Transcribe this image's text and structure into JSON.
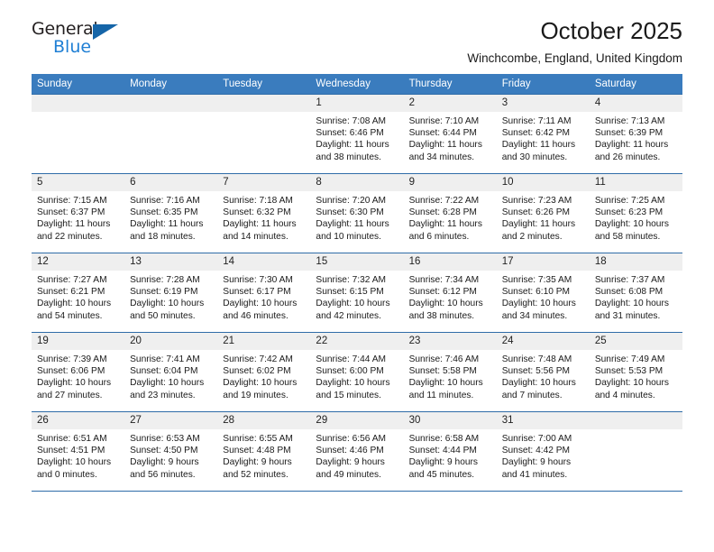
{
  "brand": {
    "name_part1": "General",
    "name_part2": "Blue",
    "triangle_color": "#1565a8",
    "blue_color": "#1f7fd4"
  },
  "header": {
    "title": "October 2025",
    "subtitle": "Winchcombe, England, United Kingdom"
  },
  "theme": {
    "header_bg": "#3a7cbe",
    "row_line": "#2f6ca8",
    "daynum_bg": "#efefef"
  },
  "weekdays": [
    "Sunday",
    "Monday",
    "Tuesday",
    "Wednesday",
    "Thursday",
    "Friday",
    "Saturday"
  ],
  "weeks": [
    [
      {
        "day": "",
        "empty": true,
        "sunrise": "",
        "sunset": "",
        "daylight1": "",
        "daylight2": ""
      },
      {
        "day": "",
        "empty": true,
        "sunrise": "",
        "sunset": "",
        "daylight1": "",
        "daylight2": ""
      },
      {
        "day": "",
        "empty": true,
        "sunrise": "",
        "sunset": "",
        "daylight1": "",
        "daylight2": ""
      },
      {
        "day": "1",
        "sunrise": "Sunrise: 7:08 AM",
        "sunset": "Sunset: 6:46 PM",
        "daylight1": "Daylight: 11 hours",
        "daylight2": "and 38 minutes."
      },
      {
        "day": "2",
        "sunrise": "Sunrise: 7:10 AM",
        "sunset": "Sunset: 6:44 PM",
        "daylight1": "Daylight: 11 hours",
        "daylight2": "and 34 minutes."
      },
      {
        "day": "3",
        "sunrise": "Sunrise: 7:11 AM",
        "sunset": "Sunset: 6:42 PM",
        "daylight1": "Daylight: 11 hours",
        "daylight2": "and 30 minutes."
      },
      {
        "day": "4",
        "sunrise": "Sunrise: 7:13 AM",
        "sunset": "Sunset: 6:39 PM",
        "daylight1": "Daylight: 11 hours",
        "daylight2": "and 26 minutes."
      }
    ],
    [
      {
        "day": "5",
        "sunrise": "Sunrise: 7:15 AM",
        "sunset": "Sunset: 6:37 PM",
        "daylight1": "Daylight: 11 hours",
        "daylight2": "and 22 minutes."
      },
      {
        "day": "6",
        "sunrise": "Sunrise: 7:16 AM",
        "sunset": "Sunset: 6:35 PM",
        "daylight1": "Daylight: 11 hours",
        "daylight2": "and 18 minutes."
      },
      {
        "day": "7",
        "sunrise": "Sunrise: 7:18 AM",
        "sunset": "Sunset: 6:32 PM",
        "daylight1": "Daylight: 11 hours",
        "daylight2": "and 14 minutes."
      },
      {
        "day": "8",
        "sunrise": "Sunrise: 7:20 AM",
        "sunset": "Sunset: 6:30 PM",
        "daylight1": "Daylight: 11 hours",
        "daylight2": "and 10 minutes."
      },
      {
        "day": "9",
        "sunrise": "Sunrise: 7:22 AM",
        "sunset": "Sunset: 6:28 PM",
        "daylight1": "Daylight: 11 hours",
        "daylight2": "and 6 minutes."
      },
      {
        "day": "10",
        "sunrise": "Sunrise: 7:23 AM",
        "sunset": "Sunset: 6:26 PM",
        "daylight1": "Daylight: 11 hours",
        "daylight2": "and 2 minutes."
      },
      {
        "day": "11",
        "sunrise": "Sunrise: 7:25 AM",
        "sunset": "Sunset: 6:23 PM",
        "daylight1": "Daylight: 10 hours",
        "daylight2": "and 58 minutes."
      }
    ],
    [
      {
        "day": "12",
        "sunrise": "Sunrise: 7:27 AM",
        "sunset": "Sunset: 6:21 PM",
        "daylight1": "Daylight: 10 hours",
        "daylight2": "and 54 minutes."
      },
      {
        "day": "13",
        "sunrise": "Sunrise: 7:28 AM",
        "sunset": "Sunset: 6:19 PM",
        "daylight1": "Daylight: 10 hours",
        "daylight2": "and 50 minutes."
      },
      {
        "day": "14",
        "sunrise": "Sunrise: 7:30 AM",
        "sunset": "Sunset: 6:17 PM",
        "daylight1": "Daylight: 10 hours",
        "daylight2": "and 46 minutes."
      },
      {
        "day": "15",
        "sunrise": "Sunrise: 7:32 AM",
        "sunset": "Sunset: 6:15 PM",
        "daylight1": "Daylight: 10 hours",
        "daylight2": "and 42 minutes."
      },
      {
        "day": "16",
        "sunrise": "Sunrise: 7:34 AM",
        "sunset": "Sunset: 6:12 PM",
        "daylight1": "Daylight: 10 hours",
        "daylight2": "and 38 minutes."
      },
      {
        "day": "17",
        "sunrise": "Sunrise: 7:35 AM",
        "sunset": "Sunset: 6:10 PM",
        "daylight1": "Daylight: 10 hours",
        "daylight2": "and 34 minutes."
      },
      {
        "day": "18",
        "sunrise": "Sunrise: 7:37 AM",
        "sunset": "Sunset: 6:08 PM",
        "daylight1": "Daylight: 10 hours",
        "daylight2": "and 31 minutes."
      }
    ],
    [
      {
        "day": "19",
        "sunrise": "Sunrise: 7:39 AM",
        "sunset": "Sunset: 6:06 PM",
        "daylight1": "Daylight: 10 hours",
        "daylight2": "and 27 minutes."
      },
      {
        "day": "20",
        "sunrise": "Sunrise: 7:41 AM",
        "sunset": "Sunset: 6:04 PM",
        "daylight1": "Daylight: 10 hours",
        "daylight2": "and 23 minutes."
      },
      {
        "day": "21",
        "sunrise": "Sunrise: 7:42 AM",
        "sunset": "Sunset: 6:02 PM",
        "daylight1": "Daylight: 10 hours",
        "daylight2": "and 19 minutes."
      },
      {
        "day": "22",
        "sunrise": "Sunrise: 7:44 AM",
        "sunset": "Sunset: 6:00 PM",
        "daylight1": "Daylight: 10 hours",
        "daylight2": "and 15 minutes."
      },
      {
        "day": "23",
        "sunrise": "Sunrise: 7:46 AM",
        "sunset": "Sunset: 5:58 PM",
        "daylight1": "Daylight: 10 hours",
        "daylight2": "and 11 minutes."
      },
      {
        "day": "24",
        "sunrise": "Sunrise: 7:48 AM",
        "sunset": "Sunset: 5:56 PM",
        "daylight1": "Daylight: 10 hours",
        "daylight2": "and 7 minutes."
      },
      {
        "day": "25",
        "sunrise": "Sunrise: 7:49 AM",
        "sunset": "Sunset: 5:53 PM",
        "daylight1": "Daylight: 10 hours",
        "daylight2": "and 4 minutes."
      }
    ],
    [
      {
        "day": "26",
        "sunrise": "Sunrise: 6:51 AM",
        "sunset": "Sunset: 4:51 PM",
        "daylight1": "Daylight: 10 hours",
        "daylight2": "and 0 minutes."
      },
      {
        "day": "27",
        "sunrise": "Sunrise: 6:53 AM",
        "sunset": "Sunset: 4:50 PM",
        "daylight1": "Daylight: 9 hours",
        "daylight2": "and 56 minutes."
      },
      {
        "day": "28",
        "sunrise": "Sunrise: 6:55 AM",
        "sunset": "Sunset: 4:48 PM",
        "daylight1": "Daylight: 9 hours",
        "daylight2": "and 52 minutes."
      },
      {
        "day": "29",
        "sunrise": "Sunrise: 6:56 AM",
        "sunset": "Sunset: 4:46 PM",
        "daylight1": "Daylight: 9 hours",
        "daylight2": "and 49 minutes."
      },
      {
        "day": "30",
        "sunrise": "Sunrise: 6:58 AM",
        "sunset": "Sunset: 4:44 PM",
        "daylight1": "Daylight: 9 hours",
        "daylight2": "and 45 minutes."
      },
      {
        "day": "31",
        "sunrise": "Sunrise: 7:00 AM",
        "sunset": "Sunset: 4:42 PM",
        "daylight1": "Daylight: 9 hours",
        "daylight2": "and 41 minutes."
      },
      {
        "day": "",
        "empty": true,
        "sunrise": "",
        "sunset": "",
        "daylight1": "",
        "daylight2": ""
      }
    ]
  ]
}
